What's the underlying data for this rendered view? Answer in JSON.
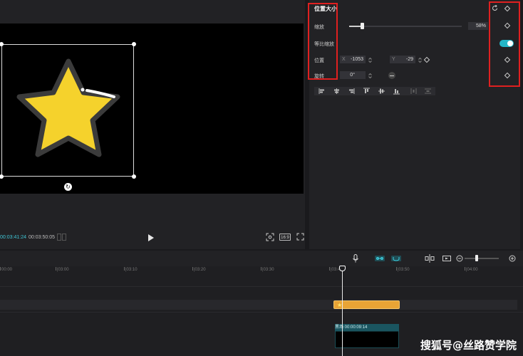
{
  "preview": {
    "time_current": "00:03:41:24",
    "time_total": "00:03:50:05",
    "ratio_label": "16:9",
    "sticker_color": "#f5d22c",
    "play_icon": "play-icon",
    "fit_icon": "fit-screen-icon",
    "fullscreen_icon": "fullscreen-icon"
  },
  "properties": {
    "section_title": "位置大小",
    "scale": {
      "label": "缩放",
      "value_text": "58%",
      "value": 0.58
    },
    "uniform_scale": {
      "label": "等比缩放",
      "enabled": true
    },
    "position": {
      "label": "位置",
      "x_label": "X",
      "x_value": "-1053",
      "y_label": "Y",
      "y_value": "-29"
    },
    "rotation": {
      "label": "旋转",
      "value": "0°"
    },
    "align_icons": [
      "align-left-icon",
      "align-center-h-icon",
      "align-right-icon",
      "align-top-icon",
      "align-center-v-icon",
      "align-bottom-icon",
      "distribute-h-icon",
      "distribute-v-icon"
    ],
    "keyframe_icon": "keyframe-diamond-icon",
    "reset_icon": "reset-icon",
    "accent_color": "#23b5c6",
    "highlight_color": "#e02020"
  },
  "timeline": {
    "ruler_ticks": [
      "00:00",
      "|03:00",
      "|03:10",
      "|03:20",
      "|03:30",
      "|03:40",
      "|03:50",
      "|04:00"
    ],
    "sticker_clip_icon": "star-icon",
    "main_clip_label": "黑场  00:00:09:14",
    "toolbar_icons": [
      "microphone-icon",
      "link-icon",
      "magnet-icon",
      "split-icon",
      "preview-icon",
      "zoom-out-icon",
      "zoom-in-icon"
    ],
    "clip_color": "#e8a435"
  },
  "watermark": "搜狐号@丝路赞学院"
}
